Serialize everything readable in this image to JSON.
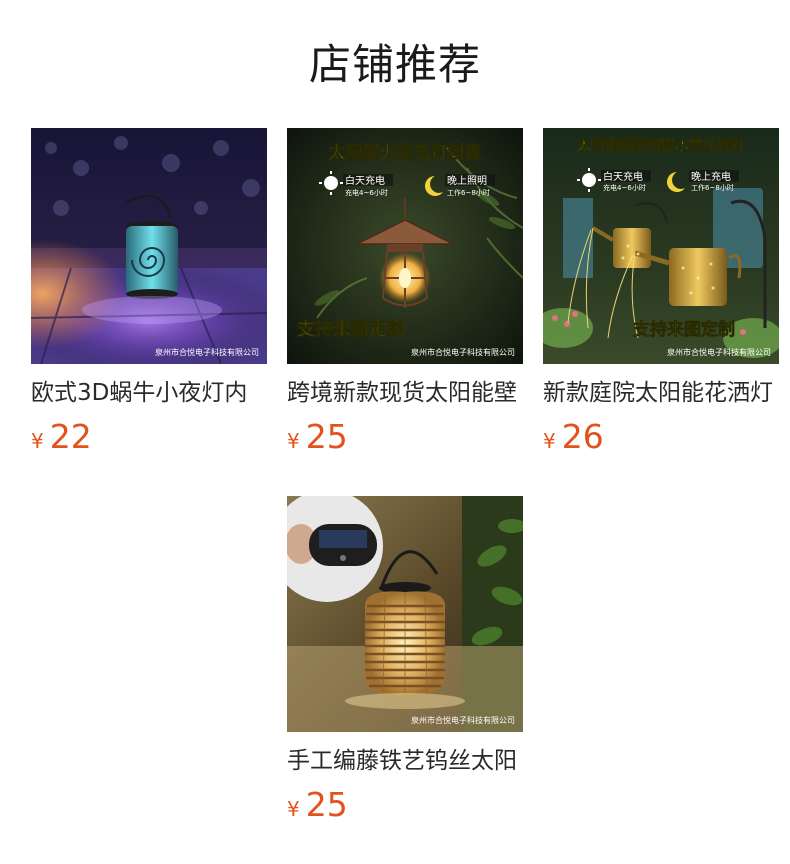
{
  "section": {
    "title": "店铺推荐"
  },
  "products": [
    {
      "title": "欧式3D蜗牛小夜灯内",
      "currency": "¥",
      "price": "22",
      "image": {
        "watermark": "泉州市合悦电子科技有限公司"
      }
    },
    {
      "title": "跨境新款现货太阳能壁",
      "currency": "¥",
      "price": "25",
      "image": {
        "banner": "太阳能火焰马灯创意",
        "day_badge": "白天充电",
        "day_note": "充电4~6小时",
        "night_badge": "晚上照明",
        "night_note": "工作6~8小时",
        "slogan": "支持来图定制",
        "watermark": "泉州市合悦电子科技有限公司"
      }
    },
    {
      "title": "新款庭院太阳能花洒灯",
      "currency": "¥",
      "price": "26",
      "image": {
        "banner": "太阳能庭院创意水壶花洒灯",
        "day_badge": "白天充电",
        "day_note": "充电4~6小时",
        "night_badge": "晚上充电",
        "night_note": "工作6~8小时",
        "slogan": "支持来图定制",
        "watermark": "泉州市合悦电子科技有限公司"
      }
    },
    {
      "title": "手工编藤铁艺钨丝太阳",
      "currency": "¥",
      "price": "25",
      "image": {
        "watermark": "泉州市合悦电子科技有限公司"
      }
    }
  ],
  "colors": {
    "price": "#e2531b",
    "title_text": "#1a1a1a",
    "banner_yellow": "#f2e23a",
    "background": "#ffffff"
  },
  "icons": {
    "sun": "sun-icon",
    "moon": "moon-icon",
    "lantern": "lantern-icon"
  }
}
